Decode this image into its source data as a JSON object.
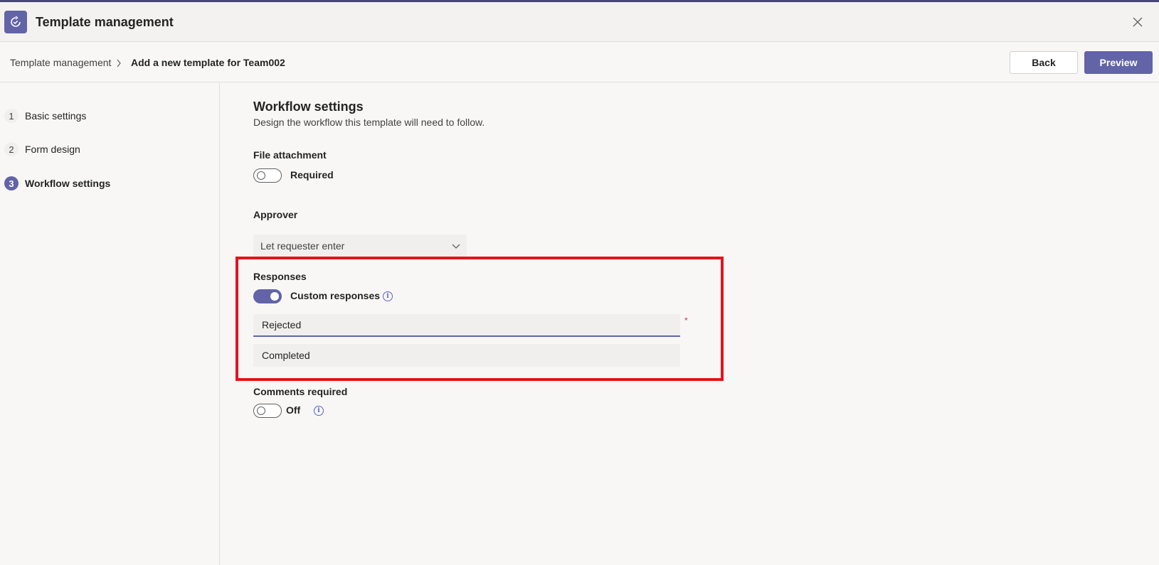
{
  "window": {
    "title": "Template management",
    "accent_color": "#6264a7",
    "close_icon": "close-icon",
    "app_icon": "refresh-check-icon"
  },
  "breadcrumb": {
    "root": "Template management",
    "current": "Add a new template for Team002"
  },
  "actions": {
    "back_label": "Back",
    "preview_label": "Preview"
  },
  "steps": [
    {
      "number": "1",
      "label": "Basic settings",
      "active": false
    },
    {
      "number": "2",
      "label": "Form design",
      "active": false
    },
    {
      "number": "3",
      "label": "Workflow settings",
      "active": true
    }
  ],
  "workflow": {
    "title": "Workflow settings",
    "subtitle": "Design the workflow this template will need to follow.",
    "file_attachment": {
      "label": "File attachment",
      "toggle_label": "Required",
      "enabled": false
    },
    "approver": {
      "label": "Approver",
      "selected": "Let requester enter"
    },
    "responses": {
      "label": "Responses",
      "toggle_label": "Custom responses",
      "enabled": true,
      "required_marker": "*",
      "items": [
        {
          "value": "Rejected",
          "focused": true
        },
        {
          "value": "Completed",
          "focused": false
        }
      ]
    },
    "comments": {
      "label": "Comments required",
      "toggle_label": "Off",
      "enabled": false
    }
  },
  "highlight_color": "#e2141c"
}
